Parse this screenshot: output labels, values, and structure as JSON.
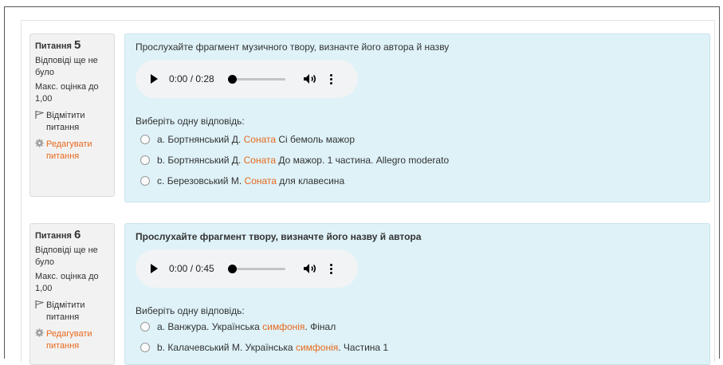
{
  "questions": [
    {
      "info": {
        "label": "Питання",
        "number": "5",
        "status": "Відповіді ще не було",
        "grade": "Макс. оцінка до 1,00",
        "flag": "Відмітити питання",
        "edit": "Редагувати питання"
      },
      "text": "Прослухайте фрагмент музичного твору, визначте його автора й назву",
      "player": {
        "time": "0:00 / 0:28",
        "progress": 0
      },
      "prompt": "Виберіть одну відповідь:",
      "answers": [
        {
          "letter": "a.",
          "pre": "Бортнянський Д.",
          "hl": "Соната",
          "post": "Сі бемоль мажор"
        },
        {
          "letter": "b.",
          "pre": "Бортнянський Д.",
          "hl": "Соната",
          "post": "До мажор. 1 частина. Allegro moderato"
        },
        {
          "letter": "c.",
          "pre": "Березовський М.",
          "hl": "Соната",
          "post": "для клавесина"
        }
      ]
    },
    {
      "info": {
        "label": "Питання",
        "number": "6",
        "status": "Відповіді ще не було",
        "grade": "Макс. оцінка до 1,00",
        "flag": "Відмітити питання",
        "edit": "Редагувати питання"
      },
      "text": "Прослухайте фрагмент твору, визначте його назву й автора",
      "player": {
        "time": "0:00 / 0:45",
        "progress": 0
      },
      "prompt": "Виберіть одну відповідь:",
      "answers": [
        {
          "letter": "a.",
          "pre": "Ванжура. Українська",
          "hl": "симфонія",
          "post": ". Фінал"
        },
        {
          "letter": "b.",
          "pre": "Калачевський М. Українська",
          "hl": "симфонія",
          "post": ". Частина 1"
        }
      ]
    }
  ],
  "colors": {
    "accent": "#e8691d",
    "content_bg": "#def2f8",
    "info_bg": "#f2f2f2"
  },
  "icons": {
    "flag": "flag-icon",
    "edit": "gear-icon",
    "play": "play-icon",
    "volume": "volume-icon",
    "more": "more-icon"
  }
}
